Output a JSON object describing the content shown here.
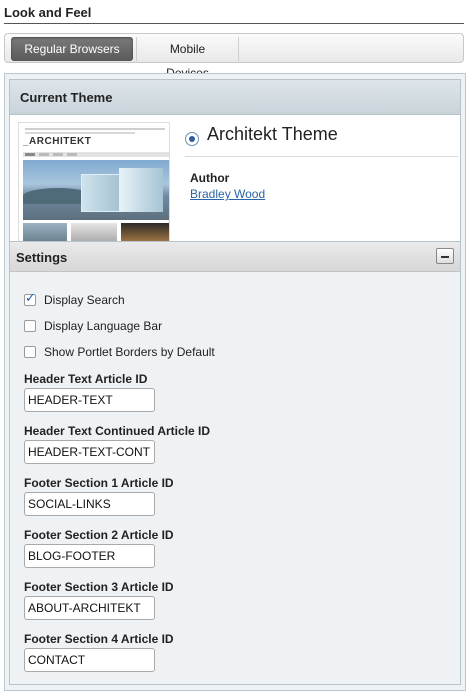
{
  "page": {
    "title": "Look and Feel"
  },
  "tabs": [
    {
      "label": "Regular Browsers",
      "active": true
    },
    {
      "label": "Mobile Devices",
      "active": false
    }
  ],
  "current_theme": {
    "header": "Current Theme",
    "thumbnail_logo": "_ARCHITEKT",
    "name": "Architekt Theme",
    "author_label": "Author",
    "author_name": "Bradley Wood",
    "selected": true
  },
  "settings": {
    "header": "Settings",
    "checkboxes": [
      {
        "label": "Display Search",
        "checked": true
      },
      {
        "label": "Display Language Bar",
        "checked": false
      },
      {
        "label": "Show Portlet Borders by Default",
        "checked": false
      }
    ],
    "fields": [
      {
        "label": "Header Text Article ID",
        "value": "HEADER-TEXT"
      },
      {
        "label": "Header Text Continued Article ID",
        "value": "HEADER-TEXT-CONT"
      },
      {
        "label": "Footer Section 1 Article ID",
        "value": "SOCIAL-LINKS"
      },
      {
        "label": "Footer Section 2 Article ID",
        "value": "BLOG-FOOTER"
      },
      {
        "label": "Footer Section 3 Article ID",
        "value": "ABOUT-ARCHITEKT"
      },
      {
        "label": "Footer Section 4 Article ID",
        "value": "CONTACT"
      }
    ]
  },
  "colors": {
    "link": "#2a64a8",
    "checkbox_check": "#1e5fb3",
    "active_tab": "#5a5a5a"
  }
}
